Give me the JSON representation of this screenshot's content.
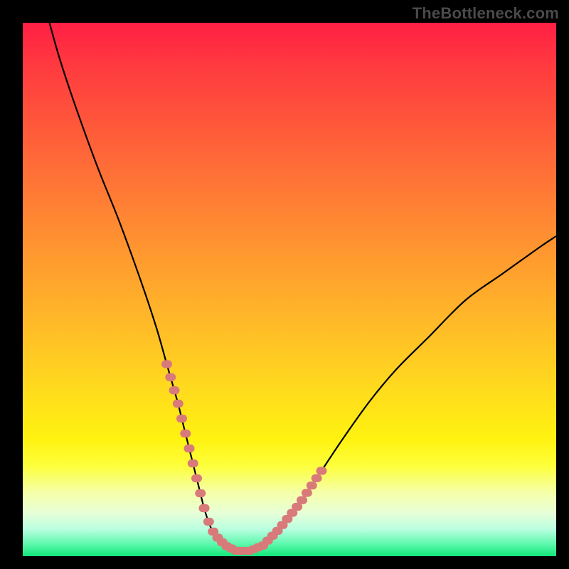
{
  "watermark": "TheBottleneck.com",
  "colors": {
    "page_bg": "#000000",
    "curve": "#000000",
    "dot_fill": "#d87a7a",
    "gradient_top": "#ff1f44",
    "gradient_bottom": "#12e67a"
  },
  "chart_data": {
    "type": "line",
    "title": "",
    "xlabel": "",
    "ylabel": "",
    "xlim": [
      0,
      100
    ],
    "ylim": [
      0,
      100
    ],
    "grid": false,
    "axes_visible": false,
    "series": [
      {
        "name": "bottleneck-curve",
        "x": [
          5,
          7,
          10,
          14,
          18,
          22,
          25,
          27,
          29,
          30,
          31,
          32,
          33,
          34,
          35,
          36,
          38,
          40,
          42.5,
          45,
          48,
          52,
          56,
          60,
          65,
          70,
          76,
          83,
          90,
          97,
          100
        ],
        "y": [
          100,
          93,
          84,
          73,
          63,
          52,
          43,
          36,
          29,
          25,
          21,
          17,
          13,
          9,
          6,
          4,
          2,
          1,
          1,
          2,
          5,
          10,
          16,
          22,
          29,
          35,
          41,
          48,
          53,
          58,
          60
        ]
      }
    ],
    "dot_clusters": [
      {
        "segment": "left-arm",
        "x_range": [
          27,
          34
        ],
        "y_range": [
          10,
          35
        ],
        "count": 11
      },
      {
        "segment": "valley",
        "x_range": [
          34,
          45
        ],
        "y_range": [
          0,
          6
        ],
        "count": 14
      },
      {
        "segment": "right-arm",
        "x_range": [
          45,
          56
        ],
        "y_range": [
          5,
          32
        ],
        "count": 13
      }
    ]
  }
}
